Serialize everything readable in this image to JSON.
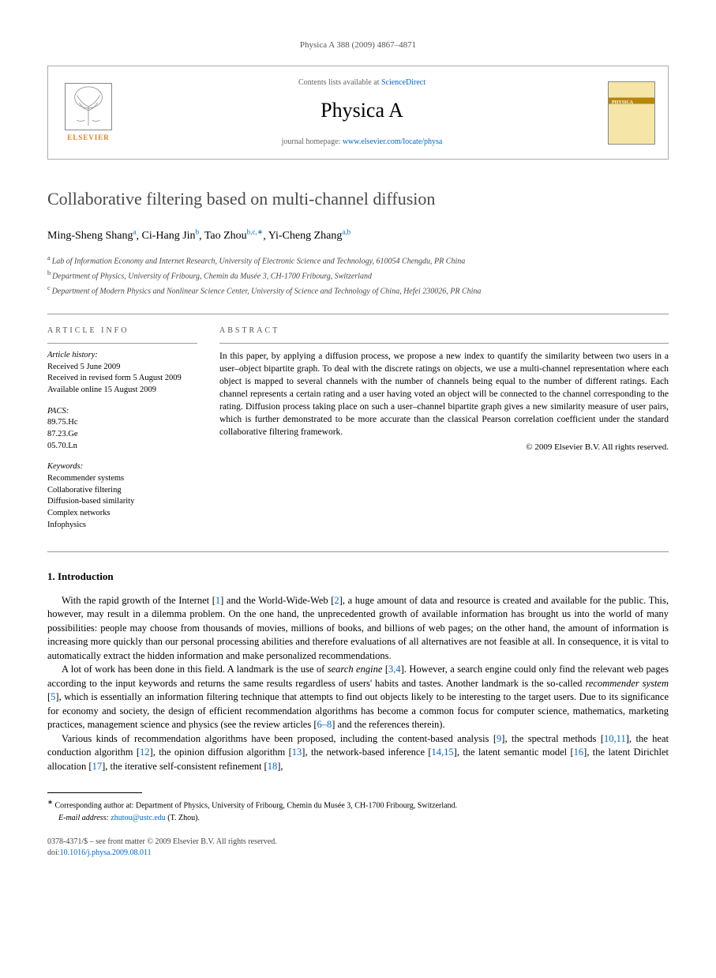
{
  "header": {
    "citation": "Physica A 388 (2009) 4867–4871",
    "contents_prefix": "Contents lists available at ",
    "contents_link": "ScienceDirect",
    "journal": "Physica A",
    "homepage_prefix": "journal homepage: ",
    "homepage_link": "www.elsevier.com/locate/physa",
    "publisher": "ELSEVIER"
  },
  "article": {
    "title": "Collaborative filtering based on multi-channel diffusion",
    "authors": [
      {
        "name": "Ming-Sheng Shang",
        "aff": "a"
      },
      {
        "name": "Ci-Hang Jin",
        "aff": "b"
      },
      {
        "name": "Tao Zhou",
        "aff": "b,c,",
        "corr": true
      },
      {
        "name": "Yi-Cheng Zhang",
        "aff": "a,b"
      }
    ],
    "affiliations": {
      "a": "Lab of Information Economy and Internet Research, University of Electronic Science and Technology, 610054 Chengdu, PR China",
      "b": "Department of Physics, University of Fribourg, Chemin du Musée 3, CH-1700 Fribourg, Switzerland",
      "c": "Department of Modern Physics and Nonlinear Science Center, University of Science and Technology of China, Hefei 230026, PR China"
    }
  },
  "info": {
    "label": "article info",
    "history_label": "Article history:",
    "history": [
      "Received 5 June 2009",
      "Received in revised form 5 August 2009",
      "Available online 15 August 2009"
    ],
    "pacs_label": "PACS:",
    "pacs": [
      "89.75.Hc",
      "87.23.Ge",
      "05.70.Ln"
    ],
    "keywords_label": "Keywords:",
    "keywords": [
      "Recommender systems",
      "Collaborative filtering",
      "Diffusion-based similarity",
      "Complex networks",
      "Infophysics"
    ]
  },
  "abstract": {
    "label": "abstract",
    "text": "In this paper, by applying a diffusion process, we propose a new index to quantify the similarity between two users in a user–object bipartite graph. To deal with the discrete ratings on objects, we use a multi-channel representation where each object is mapped to several channels with the number of channels being equal to the number of different ratings. Each channel represents a certain rating and a user having voted an object will be connected to the channel corresponding to the rating. Diffusion process taking place on such a user–channel bipartite graph gives a new similarity measure of user pairs, which is further demonstrated to be more accurate than the classical Pearson correlation coefficient under the standard collaborative filtering framework.",
    "copyright": "© 2009 Elsevier B.V. All rights reserved."
  },
  "intro": {
    "heading": "1. Introduction",
    "p1_a": "With the rapid growth of the Internet [",
    "p1_r1": "1",
    "p1_b": "] and the World-Wide-Web [",
    "p1_r2": "2",
    "p1_c": "], a huge amount of data and resource is created and available for the public. This, however, may result in a dilemma problem. On the one hand, the unprecedented growth of available information has brought us into the world of many possibilities: people may choose from thousands of movies, millions of books, and billions of web pages; on the other hand, the amount of information is increasing more quickly than our personal processing abilities and therefore evaluations of all alternatives are not feasible at all. In consequence, it is vital to automatically extract the hidden information and make personalized recommendations.",
    "p2_a": "A lot of work has been done in this field. A landmark is the use of ",
    "p2_em1": "search engine",
    "p2_b": " [",
    "p2_r1": "3,4",
    "p2_c": "]. However, a search engine could only find the relevant web pages according to the input keywords and returns the same results regardless of users' habits and tastes. Another landmark is the so-called ",
    "p2_em2": "recommender system",
    "p2_d": " [",
    "p2_r2": "5",
    "p2_e": "], which is essentially an information filtering technique that attempts to find out objects likely to be interesting to the target users. Due to its significance for economy and society, the design of efficient recommendation algorithms has become a common focus for computer science, mathematics, marketing practices, management science and physics (see the review articles [",
    "p2_r3": "6–8",
    "p2_f": "] and the references therein).",
    "p3_a": "Various kinds of recommendation algorithms have been proposed, including the content-based analysis [",
    "p3_r1": "9",
    "p3_b": "], the spectral methods [",
    "p3_r2": "10,11",
    "p3_c": "], the heat conduction algorithm [",
    "p3_r3": "12",
    "p3_d": "], the opinion diffusion algorithm [",
    "p3_r4": "13",
    "p3_e": "], the network-based inference [",
    "p3_r5": "14,15",
    "p3_f": "], the latent semantic model [",
    "p3_r6": "16",
    "p3_g": "], the latent Dirichlet allocation [",
    "p3_r7": "17",
    "p3_h": "], the iterative self-consistent refinement [",
    "p3_r8": "18",
    "p3_i": "],"
  },
  "footnote": {
    "corr_label": "Corresponding author at: ",
    "corr_text": "Department of Physics, University of Fribourg, Chemin du Musée 3, CH-1700 Fribourg, Switzerland.",
    "email_label": "E-mail address: ",
    "email": "zhutou@ustc.edu",
    "email_suffix": " (T. Zhou)."
  },
  "footer": {
    "issn": "0378-4371/$ – see front matter © 2009 Elsevier B.V. All rights reserved.",
    "doi_label": "doi:",
    "doi": "10.1016/j.physa.2009.08.011"
  }
}
